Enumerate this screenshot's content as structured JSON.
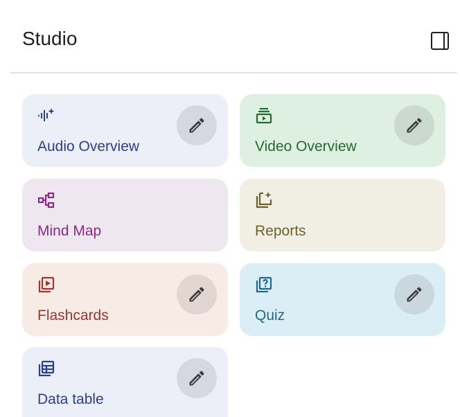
{
  "panel": {
    "title": "Studio",
    "toggle_icon": "side-panel-toggle-icon"
  },
  "cards": [
    {
      "id": "audio-overview",
      "label": "Audio Overview",
      "icon": "audio-waveform-sparkle-icon",
      "bg": "#eceef8",
      "fg": "#2b3f8c",
      "editable": true
    },
    {
      "id": "video-overview",
      "label": "Video Overview",
      "icon": "video-stack-icon",
      "bg": "#def0e1",
      "fg": "#1f6b31",
      "editable": true
    },
    {
      "id": "mind-map",
      "label": "Mind Map",
      "icon": "mind-map-icon",
      "bg": "#efe7ef",
      "fg": "#8a2a84",
      "editable": false
    },
    {
      "id": "reports",
      "label": "Reports",
      "icon": "reports-sparkle-icon",
      "bg": "#f1efe4",
      "fg": "#6e6128",
      "editable": false
    },
    {
      "id": "flashcards",
      "label": "Flashcards",
      "icon": "flashcards-icon",
      "bg": "#f7ebe6",
      "fg": "#a2332d",
      "editable": true
    },
    {
      "id": "quiz",
      "label": "Quiz",
      "icon": "quiz-icon",
      "bg": "#dceef5",
      "fg": "#1a6a8a",
      "editable": true
    },
    {
      "id": "data-table",
      "label": "Data table",
      "icon": "data-table-icon",
      "bg": "#eceef8",
      "fg": "#2b3f8c",
      "editable": true
    }
  ],
  "edit_icon": "pencil-icon"
}
